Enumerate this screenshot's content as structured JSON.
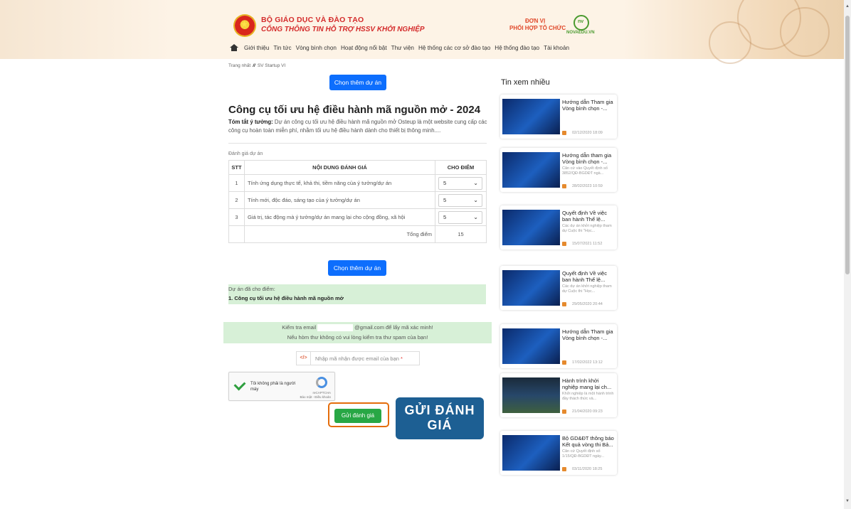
{
  "header": {
    "brand_title": "BỘ GIÁO DỤC VÀ ĐÀO TẠO",
    "brand_subtitle": "CỔNG THÔNG TIN HỖ TRỢ HSSV KHỞI NGHIỆP",
    "partner_label_line1": "ĐƠN VỊ",
    "partner_label_line2": "PHỐI HỢP TỔ CHỨC",
    "partner_name": "NOVAEDU.VN",
    "partner_logo_text": "nv"
  },
  "nav": {
    "items": [
      "Giới thiệu",
      "Tin tức",
      "Vòng bình chọn",
      "Hoạt động nổi bật",
      "Thư viện",
      "Hệ thống các cơ sở đào tạo",
      "Hệ thống đào tạo",
      "Tài khoản"
    ]
  },
  "breadcrumb": {
    "home": "Trang nhất",
    "separator": "//",
    "current": "SV Startup VI"
  },
  "buttons": {
    "choose_more": "Chọn thêm dự án",
    "submit": "Gửi đánh giá"
  },
  "project": {
    "title": "Công cụ tối ưu hệ điều hành mã nguồn mở - 2024",
    "summary_label": "Tóm tắt ý tưởng:",
    "summary_text": "Dự án công cụ tối ưu hệ điều hành mã nguồn mở Osteup là một website cung cấp các công cụ hoàn toàn miễn phí, nhằm tối ưu hệ điều hành dành cho thiết bị thông minh...."
  },
  "evaluation": {
    "label": "Đánh giá dự án",
    "headers": [
      "STT",
      "NỘI DUNG ĐÁNH GIÁ",
      "CHO ĐIỂM"
    ],
    "rows": [
      {
        "stt": "1",
        "content": "Tính ứng dụng thực tế, khả thi, tiềm năng của ý tưởng/dự án",
        "score": "5"
      },
      {
        "stt": "2",
        "content": "Tính mới, độc đáo, sáng tạo của ý tưởng/dự án",
        "score": "5"
      },
      {
        "stt": "3",
        "content": "Giá trị, tác động mà ý tưởng/dự án mang lại cho cộng đồng, xã hội",
        "score": "5"
      }
    ],
    "total_label": "Tổng điểm",
    "total_value": "15"
  },
  "rated": {
    "label": "Dự án đã cho điểm:",
    "item": "1. Công cụ tối ưu hệ điều hành mã nguồn mở"
  },
  "email_notice": {
    "line1_prefix": "Kiểm tra email",
    "line1_suffix": "@gmail.com để lấy mã xác minh!",
    "line2": "Nếu hòm thư không có vui lòng kiểm tra thư spam của bạn!"
  },
  "code_input": {
    "icon": "</>",
    "placeholder": "Nhập mã nhận được email của bạn",
    "required_mark": "*"
  },
  "recaptcha": {
    "label": "Tôi không phải là người máy",
    "brand": "reCAPTCHA",
    "links": "Bảo mật - Điều khoản"
  },
  "callout": {
    "line1": "GỬI ĐÁNH",
    "line2": "GIÁ"
  },
  "sidebar": {
    "title": "Tin xem nhiều",
    "cards": [
      {
        "title": "Hướng dẫn Tham gia Vòng bình chọn -...",
        "desc": "",
        "date": "02/12/2020 18:09",
        "icon": "news-thumbnail"
      },
      {
        "title": "Hướng dẫn tham gia Vòng bình chọn -...",
        "desc": "Căn cứ vào Quyết định số 3852/QĐ-BGDĐT ngà...",
        "date": "28/02/2023 10:59",
        "icon": "news-thumbnail"
      },
      {
        "title": "Quyết định Về việc ban hành Thể lệ...",
        "desc": "Các dự án khởi nghiệp tham dự Cuộc thi \"Học...",
        "date": "15/07/2021 11:52",
        "icon": "news-thumbnail"
      },
      {
        "title": "Quyết định Về việc ban hành Thể lệ...",
        "desc": "Các dự án khởi nghiệp tham dự Cuộc thi \"Học...",
        "date": "29/05/2020 20:44",
        "icon": "news-thumbnail"
      },
      {
        "title": "Hướng dẫn Tham gia Vòng bình chọn -...",
        "desc": "",
        "date": "17/02/2022 13:12",
        "icon": "news-thumbnail"
      },
      {
        "title": "Hành trình khởi nghiệp mang lại ch...",
        "desc": "Khởi nghiệp là một hành trình đầy thách thức và...",
        "date": "21/04/2020 09:23",
        "icon": "news-thumbnail"
      },
      {
        "title": "Bộ GD&ĐT thông báo Kết quả vòng thi Bả...",
        "desc": "Căn cứ Quyết định số 1/15/QĐ-BGDĐT ngày...",
        "date": "03/11/2020 18:25",
        "icon": "news-thumbnail"
      }
    ]
  },
  "colors": {
    "primary": "#0d6efd",
    "success": "#28a745",
    "header_bg": "#fdf3e6",
    "brand_red": "#d42b2b",
    "callout_bg": "#1d5f93",
    "highlight_outline": "#e46c0a",
    "notice_bg": "#d7f0d7"
  }
}
